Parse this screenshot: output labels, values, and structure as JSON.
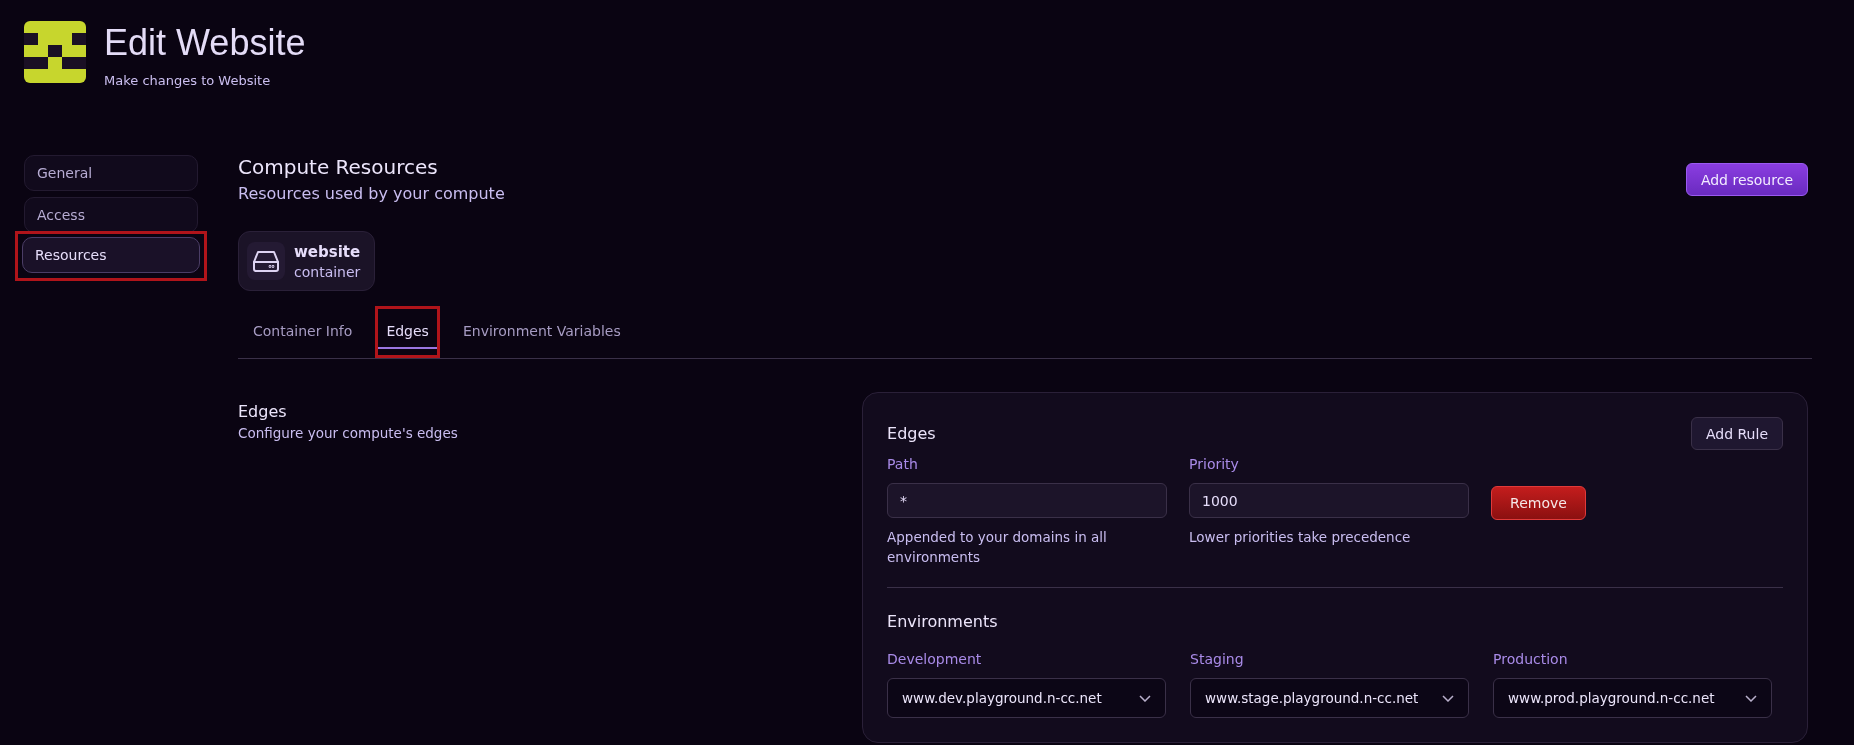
{
  "header": {
    "title": "Edit Website",
    "subtitle": "Make changes to Website"
  },
  "sidebar": {
    "items": [
      {
        "label": "General",
        "selected": false,
        "highlighted": false
      },
      {
        "label": "Access",
        "selected": false,
        "highlighted": false
      },
      {
        "label": "Resources",
        "selected": true,
        "highlighted": true
      }
    ]
  },
  "section": {
    "title": "Compute Resources",
    "subtitle": "Resources used by your compute",
    "add_button": "Add resource"
  },
  "resource": {
    "name": "website",
    "type": "container"
  },
  "tabs": [
    {
      "label": "Container Info",
      "selected": false,
      "highlighted": false
    },
    {
      "label": "Edges",
      "selected": true,
      "highlighted": true
    },
    {
      "label": "Environment Variables",
      "selected": false,
      "highlighted": false
    }
  ],
  "edges_intro": {
    "title": "Edges",
    "subtitle": "Configure your compute's edges"
  },
  "edges_panel": {
    "title": "Edges",
    "add_button": "Add Rule",
    "rules": [
      {
        "path_label": "Path",
        "path_value": "*",
        "path_help": "Appended to your domains in all environments",
        "priority_label": "Priority",
        "priority_value": "1000",
        "priority_help": "Lower priorities take precedence",
        "remove_button": "Remove"
      }
    ],
    "environments_title": "Environments",
    "environments": [
      {
        "label": "Development",
        "value": "www.dev.playground.n-cc.net"
      },
      {
        "label": "Staging",
        "value": "www.stage.playground.n-cc.net"
      },
      {
        "label": "Production",
        "value": "www.prod.playground.n-cc.net"
      }
    ]
  }
}
